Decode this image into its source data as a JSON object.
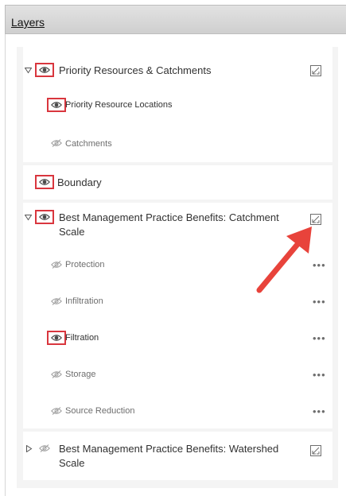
{
  "panel": {
    "title": "Layers"
  },
  "colors": {
    "highlight_box": "#d9363e",
    "annotation_arrow": "#e8433b",
    "eye_on": "#4a4a4a",
    "eye_off": "#9e9e9e",
    "list_background": "#f4f4f4"
  },
  "icons": {
    "visible": "eye-icon",
    "hidden": "eye-slash-icon",
    "legend": "legend-icon",
    "expanded": "caret-down-icon",
    "collapsed": "caret-right-icon",
    "more": "ellipsis-icon"
  },
  "layers": [
    {
      "label": "Priority Resources & Catchments",
      "expanded": true,
      "visible": true,
      "highlighted": true,
      "children": [
        {
          "label": "Priority Resource Locations",
          "visible": true,
          "highlighted": true
        },
        {
          "label": "Catchments",
          "visible": false,
          "highlighted": false
        }
      ]
    },
    {
      "label": "Boundary",
      "visible": true,
      "highlighted": true
    },
    {
      "label": "Best Management Practice Benefits: Catchment Scale",
      "expanded": true,
      "visible": true,
      "highlighted": true,
      "children": [
        {
          "label": "Protection",
          "visible": false,
          "highlighted": false
        },
        {
          "label": "Infiltration",
          "visible": false,
          "highlighted": false
        },
        {
          "label": "Filtration",
          "visible": true,
          "highlighted": true
        },
        {
          "label": "Storage",
          "visible": false,
          "highlighted": false
        },
        {
          "label": "Source Reduction",
          "visible": false,
          "highlighted": false
        }
      ]
    },
    {
      "label": "Best Management Practice Benefits: Watershed Scale",
      "expanded": false,
      "visible": false,
      "highlighted": false
    }
  ],
  "group_label_lines": {
    "catchment_line1": "Best Management Practice Benefits: Catchment",
    "catchment_line2": "Scale",
    "watershed_line1": "Best Management Practice Benefits: Watershed",
    "watershed_line2": "Scale"
  },
  "more_label": "•••"
}
